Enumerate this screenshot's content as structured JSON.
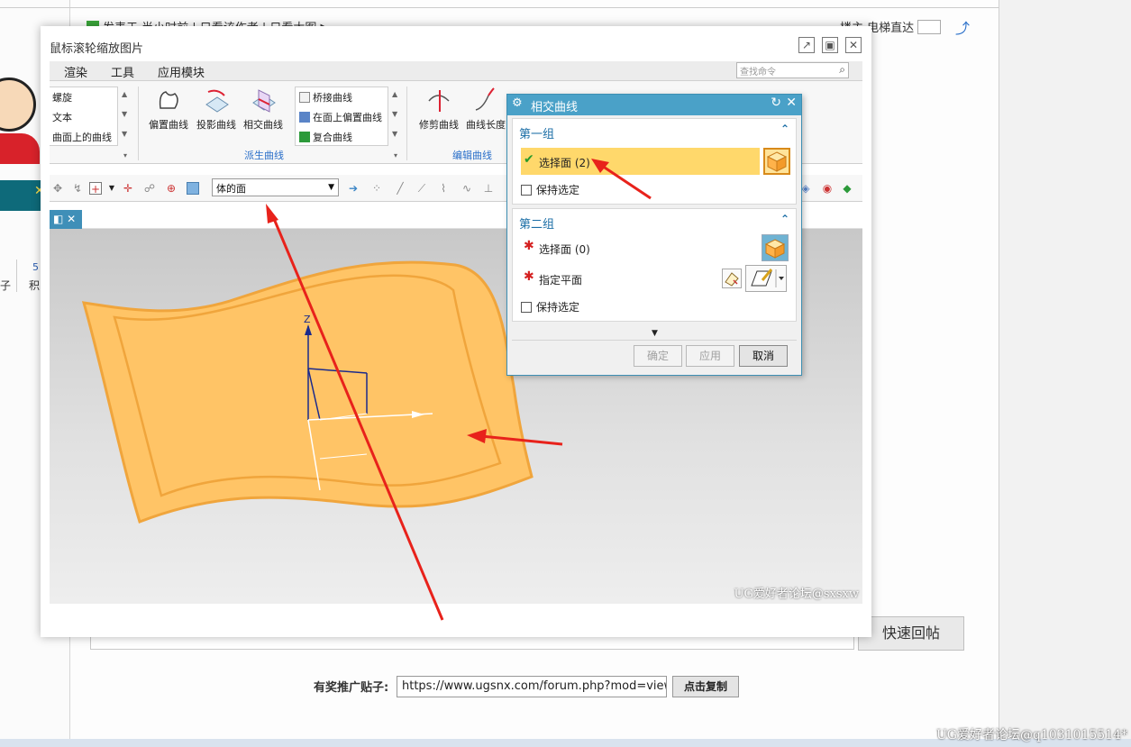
{
  "background": {
    "post_meta": "发表于 半小时前 | 只看该作者 | 只看大图 ▶",
    "floor_label": "楼主",
    "elevator_label": "电梯直达",
    "stats_a": "子",
    "stats_b": "5",
    "stats_c": "积",
    "reply_placeholder": "",
    "reply_button": "快速回帖",
    "promo_label": "有奖推广贴子:",
    "promo_url": "https://www.ugsnx.com/forum.php?mod=viewthread",
    "promo_copy": "点击复制",
    "watermark": "UG爱好者论坛@q1031015514*"
  },
  "lightbox": {
    "title": "鼠标滚轮缩放图片"
  },
  "nx": {
    "menu": [
      "渲染",
      "工具",
      "应用模块"
    ],
    "search_placeholder": "查找命令",
    "list1": [
      "螺旋",
      "文本",
      "曲面上的曲线"
    ],
    "big_buttons": [
      "偏置曲线",
      "投影曲线",
      "相交曲线"
    ],
    "list2": [
      "桥接曲线",
      "在面上偏置曲线",
      "复合曲线"
    ],
    "edit_buttons": [
      "修剪曲线",
      "曲线长度"
    ],
    "group_derived": "派生曲线",
    "group_edit": "编辑曲线",
    "filter_value": "体的面",
    "viewport_watermark": "UG爱好者论坛@sxsxw",
    "axis_label": "Z"
  },
  "dialog": {
    "title": "相交曲线",
    "group1": {
      "title": "第一组",
      "select_face": "选择面 (2)",
      "keep": "保持选定"
    },
    "group2": {
      "title": "第二组",
      "select_face": "选择面 (0)",
      "specify_plane": "指定平面",
      "keep": "保持选定"
    },
    "buttons": {
      "ok": "确定",
      "apply": "应用",
      "cancel": "取消"
    }
  },
  "colors": {
    "surface": "#ffc466",
    "dialog_header": "#4aa1c8",
    "highlight": "#ffd86b",
    "annotation_arrow": "#e8221b"
  }
}
